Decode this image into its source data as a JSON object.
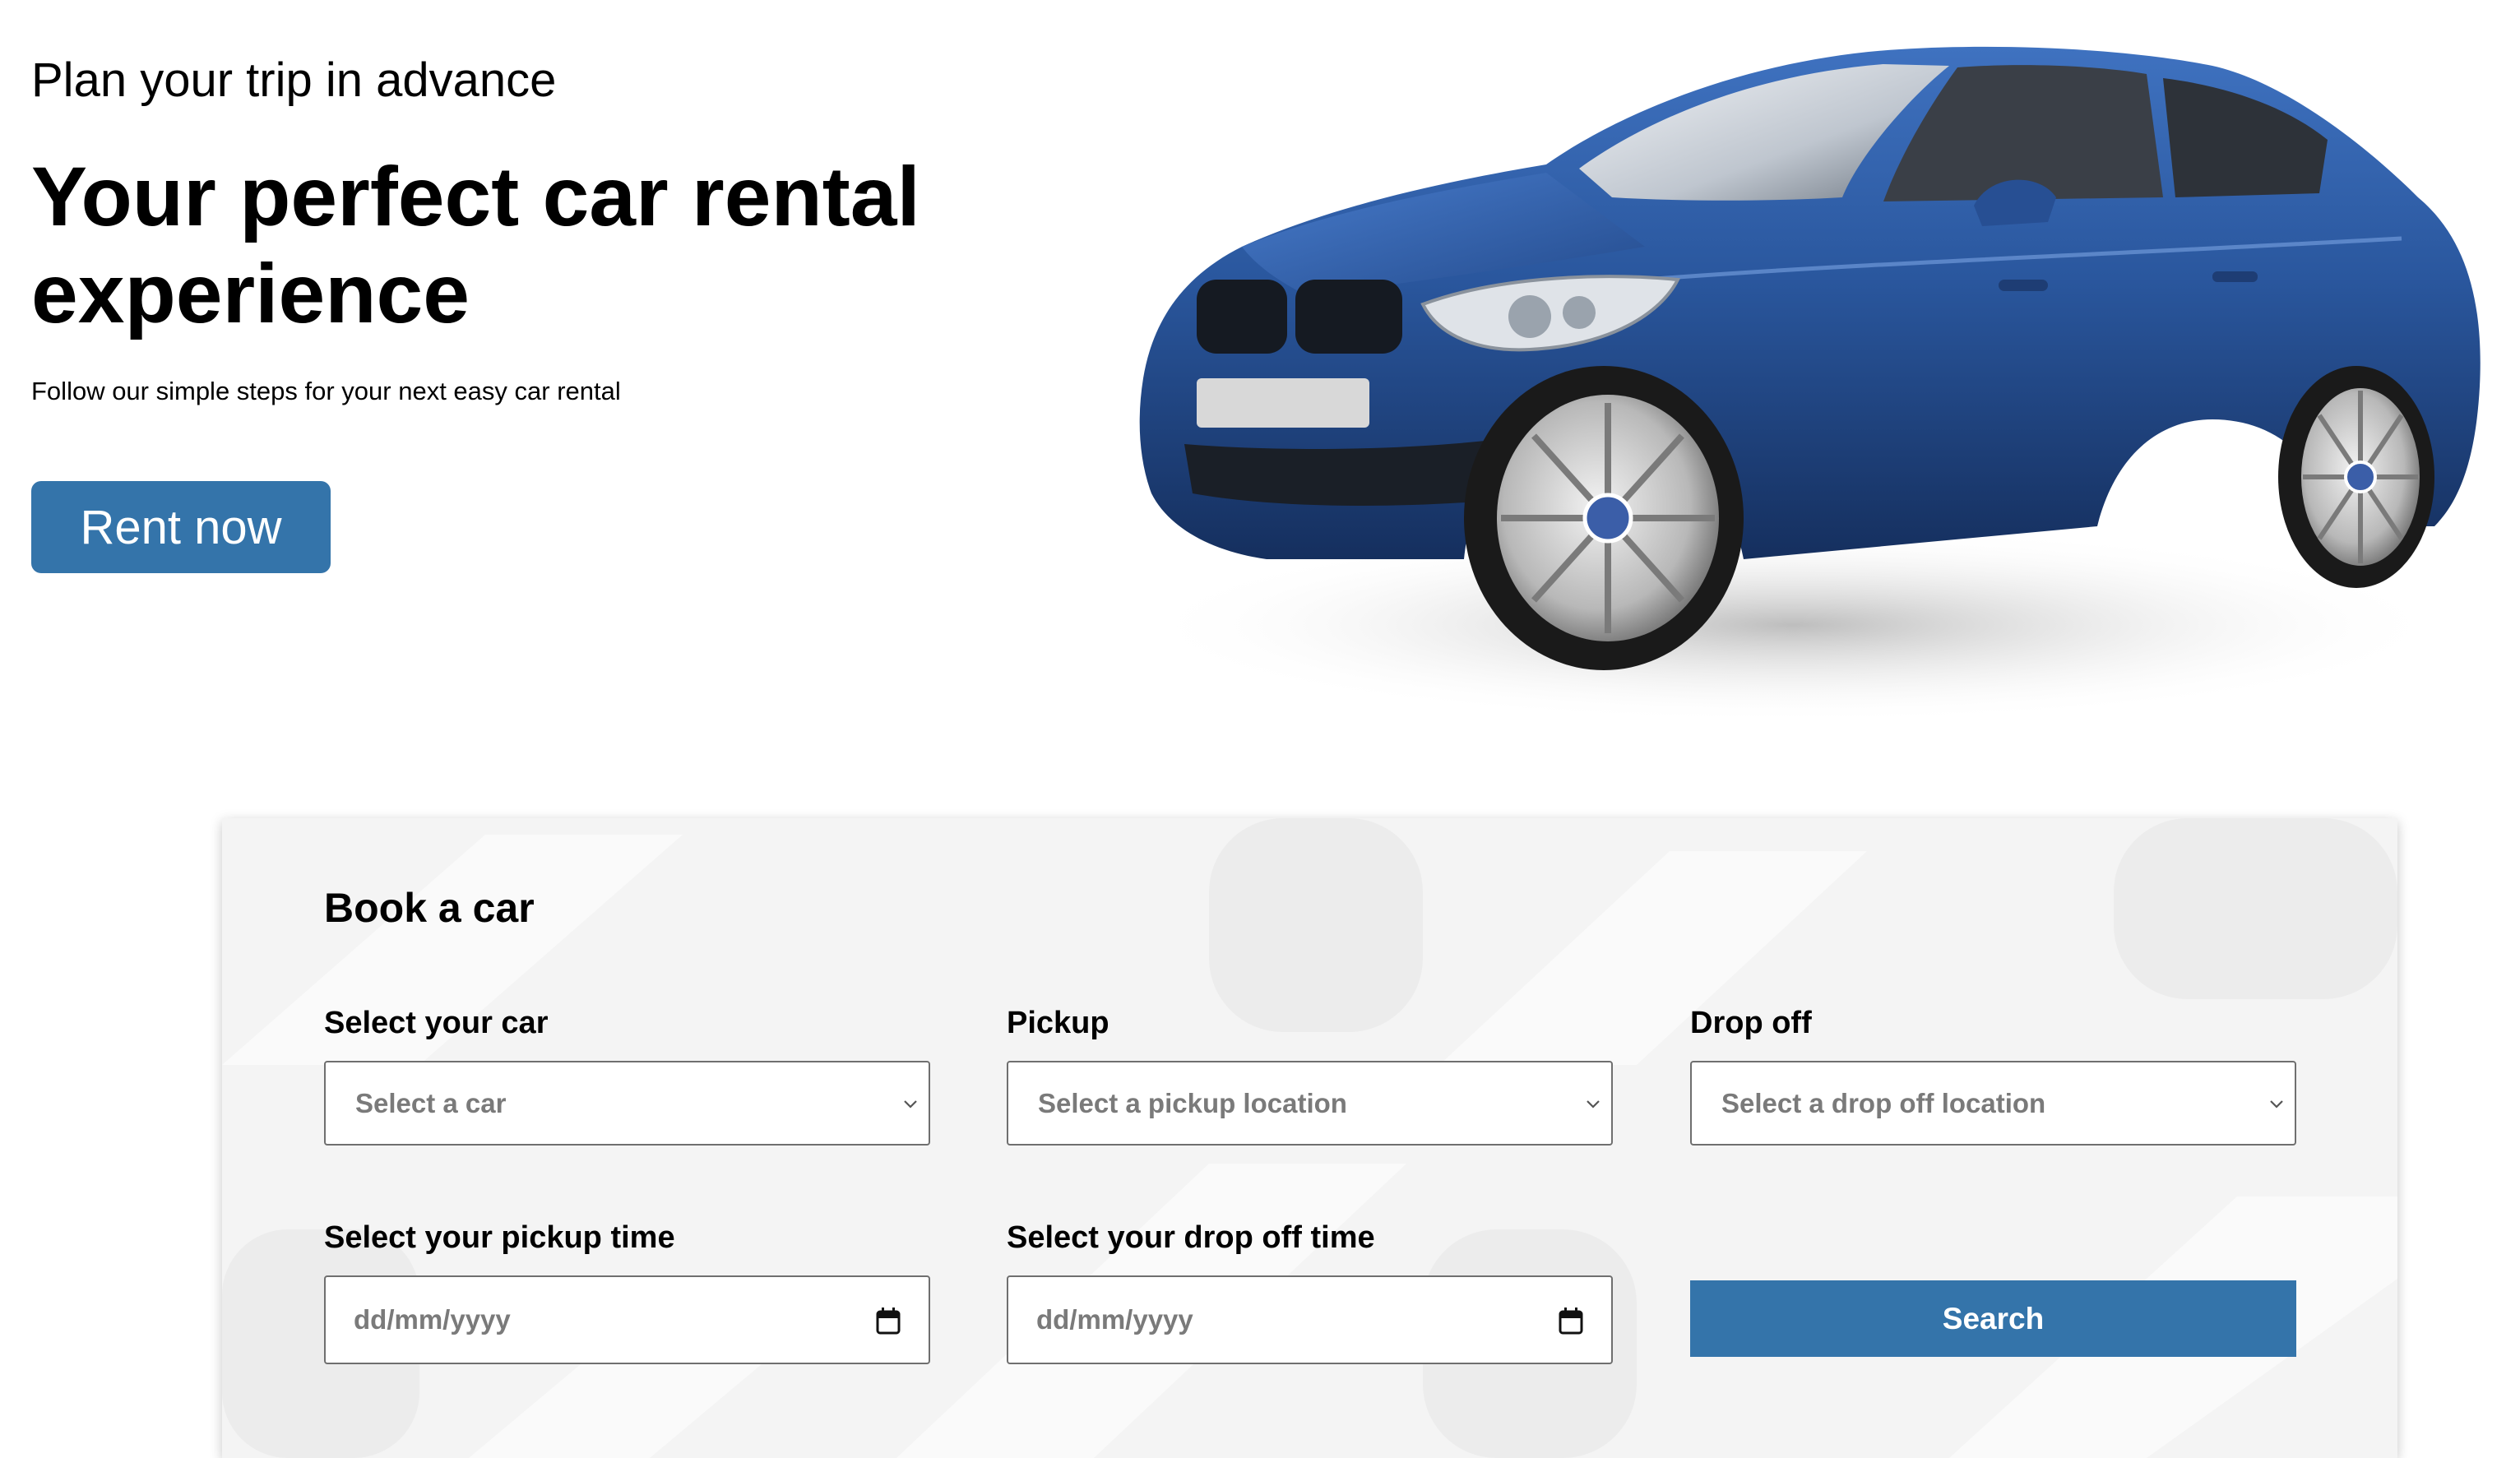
{
  "hero": {
    "eyebrow": "Plan your trip in advance",
    "title": "Your perfect car rental experience",
    "subtitle": "Follow our simple steps for your next easy car rental",
    "cta_label": "Rent now"
  },
  "booking": {
    "title": "Book a car",
    "car": {
      "label": "Select your car",
      "placeholder": "Select a car"
    },
    "pickup": {
      "label": "Pickup",
      "placeholder": "Select a pickup location"
    },
    "dropoff": {
      "label": "Drop off",
      "placeholder": "Select a drop off location"
    },
    "pickup_time": {
      "label": "Select your pickup time",
      "placeholder": "dd/mm/yyyy"
    },
    "dropoff_time": {
      "label": "Select your drop off time",
      "placeholder": "dd/mm/yyyy"
    },
    "search_label": "Search"
  },
  "colors": {
    "accent": "#3474aa",
    "car_body": "#2a579e",
    "card_background": "#f4f4f4"
  },
  "icons": {
    "select_chevron": "chevron-down-icon",
    "date_picker": "calendar-icon"
  }
}
